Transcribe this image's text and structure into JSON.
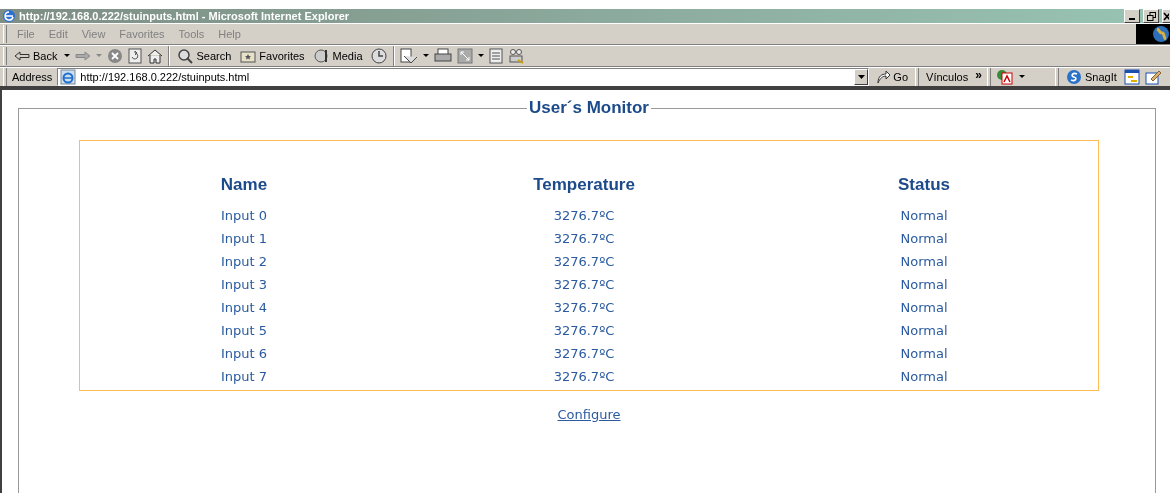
{
  "window": {
    "title": "http://192.168.0.222/stuinputs.html - Microsoft Internet Explorer"
  },
  "menu": [
    "File",
    "Edit",
    "View",
    "Favorites",
    "Tools",
    "Help"
  ],
  "toolbar": {
    "back": "Back",
    "search": "Search",
    "favorites": "Favorites",
    "media": "Media"
  },
  "address_bar": {
    "label": "Address",
    "url": "http://192.168.0.222/stuinputs.html",
    "go": "Go",
    "links": "Vínculos",
    "links_more": "»",
    "snagit": "SnagIt"
  },
  "monitor": {
    "legend": "User´s Monitor",
    "columns": [
      "Name",
      "Temperature",
      "Status"
    ],
    "rows": [
      {
        "name": "Input 0",
        "temperature": "3276.7ºC",
        "status": "Normal"
      },
      {
        "name": "Input 1",
        "temperature": "3276.7ºC",
        "status": "Normal"
      },
      {
        "name": "Input 2",
        "temperature": "3276.7ºC",
        "status": "Normal"
      },
      {
        "name": "Input 3",
        "temperature": "3276.7ºC",
        "status": "Normal"
      },
      {
        "name": "Input 4",
        "temperature": "3276.7ºC",
        "status": "Normal"
      },
      {
        "name": "Input 5",
        "temperature": "3276.7ºC",
        "status": "Normal"
      },
      {
        "name": "Input 6",
        "temperature": "3276.7ºC",
        "status": "Normal"
      },
      {
        "name": "Input 7",
        "temperature": "3276.7ºC",
        "status": "Normal"
      }
    ],
    "link": "Configure"
  }
}
